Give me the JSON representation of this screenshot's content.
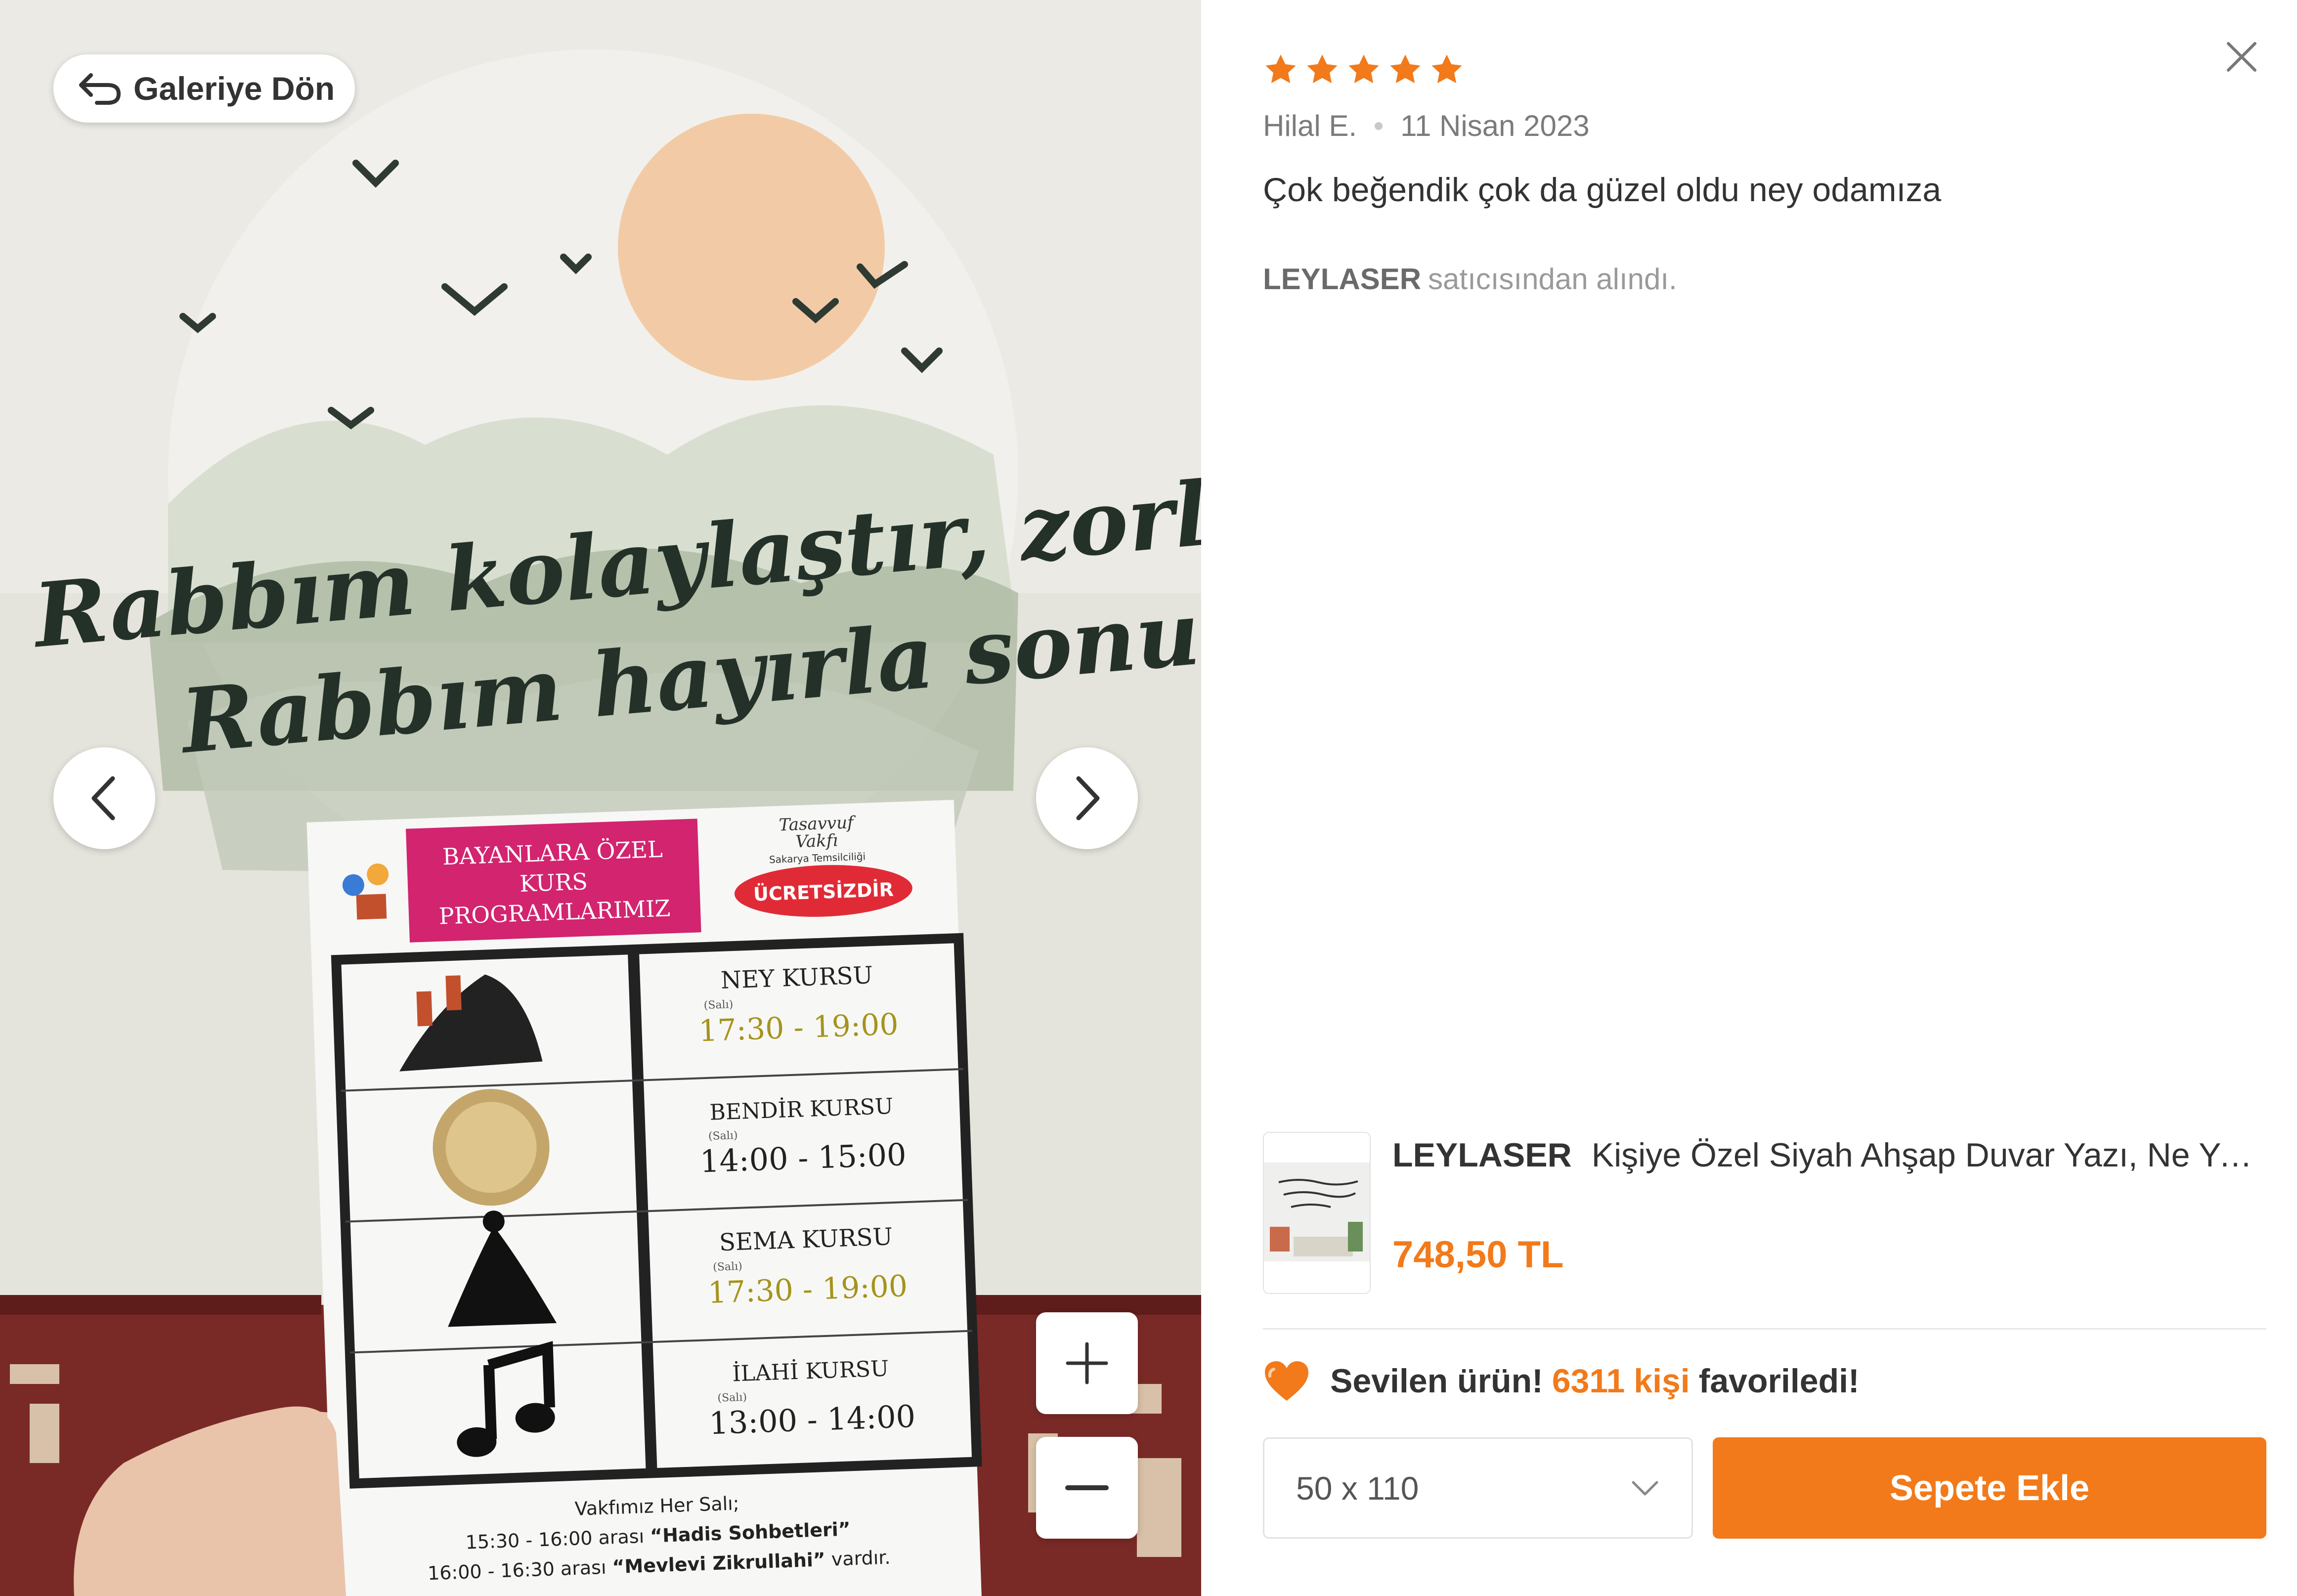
{
  "gallery": {
    "back_label": "Galeriye Dön",
    "photo": {
      "wall_text_line1": "Rabbım kolaylaştır, zorlaştırma",
      "wall_text_line2": "Rabbım hayırla sonuçlandır...",
      "flyer": {
        "header": [
          "BAYANLARA ÖZEL",
          "KURS",
          "PROGRAMLARIMIZ"
        ],
        "org": [
          "Tasavvuf",
          "Vakfı",
          "Sakarya Temsilciliği"
        ],
        "badge": "ÜCRETSİZDİR",
        "courses": [
          {
            "name": "NEY KURSU",
            "day": "(Salı)",
            "time": "17:30 - 19:00"
          },
          {
            "name": "BENDİR KURSU",
            "day": "(Salı)",
            "time": "14:00 - 15:00"
          },
          {
            "name": "SEMA KURSU",
            "day": "(Salı)",
            "time": "17:30 - 19:00"
          },
          {
            "name": "İLAHİ KURSU",
            "day": "(Salı)",
            "time": "13:00 - 14:00"
          }
        ],
        "footer_line1": "Vakfımız Her Salı;",
        "footer_line2_prefix": "15:30 - 16:00 arası ",
        "footer_line2_bold": "“Hadis Sohbetleri”",
        "footer_line3_prefix": "16:00 - 16:30 arası ",
        "footer_line3_bold": "“Mevlevi Zikrullahi”",
        "footer_line3_suffix": " vardır."
      }
    }
  },
  "review": {
    "rating": 5,
    "author": "Hilal E.",
    "date": "11 Nisan 2023",
    "text": "Çok beğendik çok da güzel oldu ney odamıza",
    "seller_name": "LEYLASER",
    "seller_suffix": "satıcısından alındı."
  },
  "product": {
    "brand": "LEYLASER",
    "title": "Kişiye Özel Siyah Ahşap Duvar Yazı, Ne Yazılarak Sipariş Verilirse Yazılır",
    "price": "748,50 TL"
  },
  "favorite": {
    "prefix": "Sevilen ürün!",
    "count": "6311",
    "kisi": "kişi",
    "suffix": "favoriledi!"
  },
  "size_select": {
    "value": "50 x 110"
  },
  "add_to_cart_label": "Sepete Ekle",
  "colors": {
    "accent": "#f27a1a",
    "star": "#f27a1a"
  }
}
